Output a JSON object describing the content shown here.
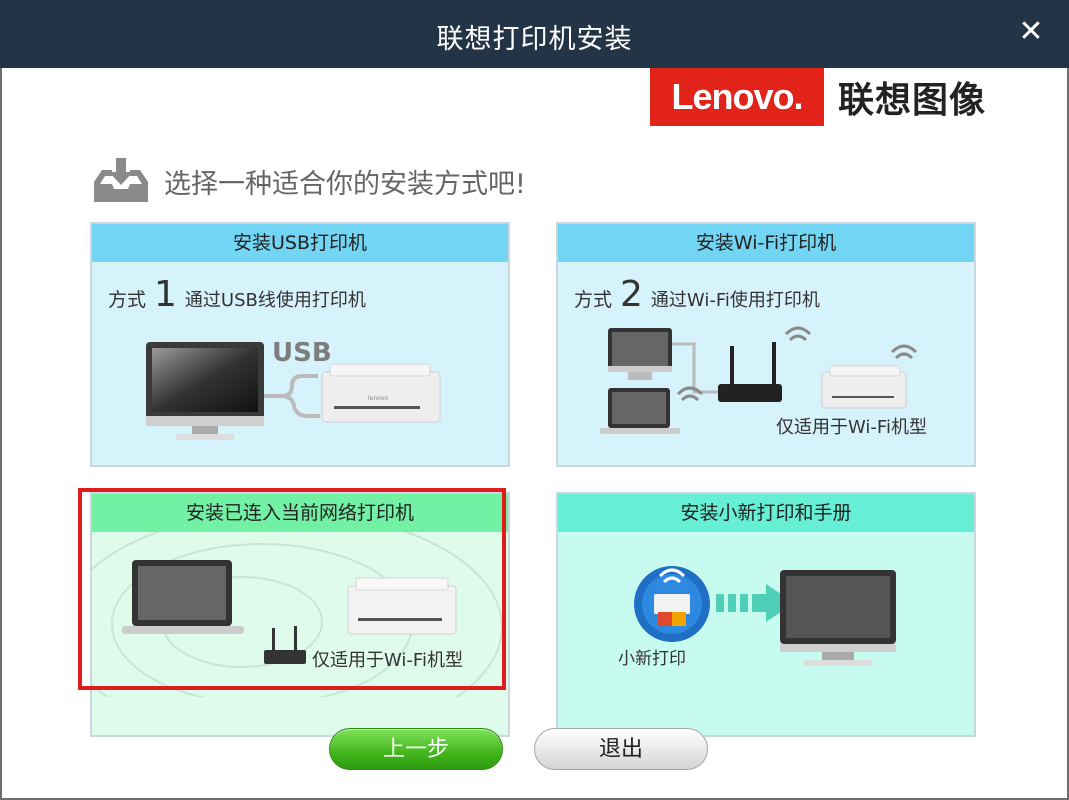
{
  "window": {
    "title": "联想打印机安装",
    "close_glyph": "✕"
  },
  "brand": {
    "logo": "Lenovo.",
    "name": "联想图像"
  },
  "heading": {
    "text": "选择一种适合你的安装方式吧!"
  },
  "cards": {
    "usb": {
      "title": "安装USB打印机",
      "method_label": "方式",
      "method_number": "1",
      "method_desc": "通过USB线使用打印机",
      "cable_label": "USB"
    },
    "wifi": {
      "title": "安装Wi-Fi打印机",
      "method_label": "方式",
      "method_number": "2",
      "method_desc": "通过Wi-Fi使用打印机",
      "note": "仅适用于Wi-Fi机型"
    },
    "network": {
      "title": "安装已连入当前网络打印机",
      "note": "仅适用于Wi-Fi机型",
      "selected": true
    },
    "app": {
      "title": "安装小新打印和手册",
      "app_name": "小新打印"
    }
  },
  "buttons": {
    "back": "上一步",
    "exit": "退出"
  },
  "colors": {
    "titlebar": "#243447",
    "usb_header": "#72d5f3",
    "network_header": "#72f1a5",
    "app_header": "#66efd4",
    "selection": "#e01d1d",
    "brand_red": "#e2231a"
  }
}
